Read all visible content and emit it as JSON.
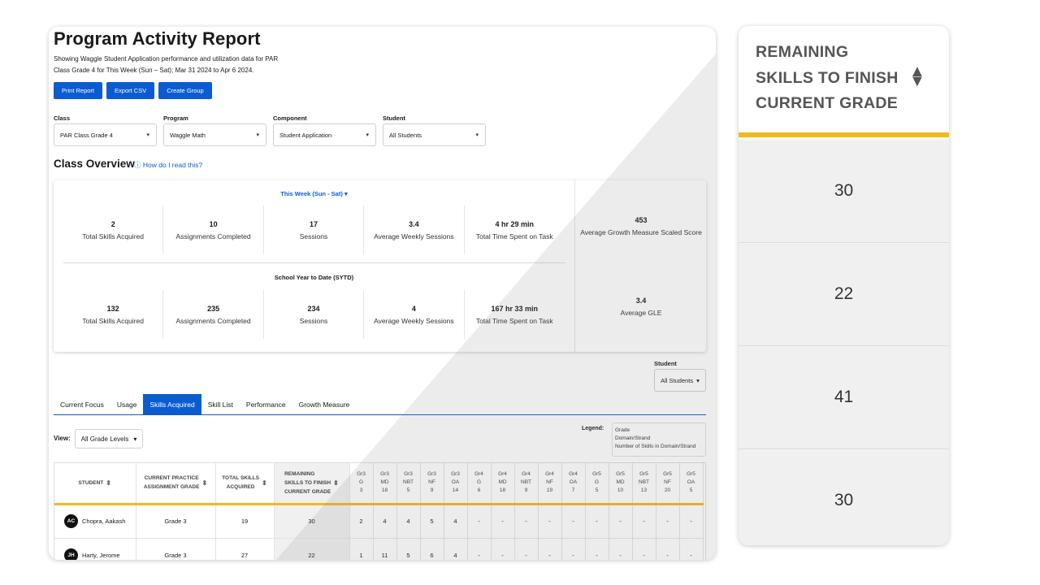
{
  "header": {
    "title": "Program Activity Report",
    "subtitle_line1": "Showing Waggle Student Application performance and utilization data for PAR",
    "subtitle_line2": "Class Grade 4 for This Week (Sun – Sat); Mar 31 2024 to Apr 6 2024."
  },
  "actions": {
    "print": "Print Report",
    "export": "Export CSV",
    "create_group": "Create Group"
  },
  "filters": [
    {
      "label": "Class",
      "value": "PAR Class Grade 4"
    },
    {
      "label": "Program",
      "value": "Waggle Math"
    },
    {
      "label": "Component",
      "value": "Student Application"
    },
    {
      "label": "Student",
      "value": "All Students"
    }
  ],
  "overview": {
    "title": "Class Overview",
    "help_link": "How do I read this?",
    "week_label": "This Week (Sun - Sat)",
    "week_stats": [
      {
        "value": "2",
        "label": "Total Skills Acquired"
      },
      {
        "value": "10",
        "label": "Assignments Completed"
      },
      {
        "value": "17",
        "label": "Sessions"
      },
      {
        "value": "3.4",
        "label": "Average Weekly Sessions"
      },
      {
        "value": "4 hr 29 min",
        "label": "Total Time Spent on Task"
      }
    ],
    "sytd_label": "School Year to Date (SYTD)",
    "sytd_stats": [
      {
        "value": "132",
        "label": "Total Skills Acquired"
      },
      {
        "value": "235",
        "label": "Assignments Completed"
      },
      {
        "value": "234",
        "label": "Sessions"
      },
      {
        "value": "4",
        "label": "Average Weekly Sessions"
      },
      {
        "value": "167 hr 33 min",
        "label": "Total Time Spent on Task"
      }
    ],
    "growth": {
      "value": "453",
      "label": "Average Growth Measure Scaled Score"
    },
    "gle": {
      "value": "3.4",
      "label": "Average GLE"
    }
  },
  "student_filter": {
    "label": "Student",
    "value": "All Students"
  },
  "tabs": [
    "Current Focus",
    "Usage",
    "Skills Acquired",
    "Skill List",
    "Performance",
    "Growth Measure"
  ],
  "view": {
    "label": "View:",
    "value": "All Grade Levels"
  },
  "legend": {
    "label": "Legend:",
    "line1": "Grade",
    "line2": "Domain/Strand",
    "line3": "Number of Skills in Domain/Strand"
  },
  "table": {
    "headers": {
      "student": "STUDENT",
      "practice_l1": "CURRENT PRACTICE",
      "practice_l2": "ASSIGNMENT GRADE",
      "total_l1": "TOTAL SKILLS",
      "total_l2": "ACQUIRED",
      "remaining_l1": "REMAINING",
      "remaining_l2": "SKILLS TO FINISH",
      "remaining_l3": "CURRENT GRADE"
    },
    "grade_cols": [
      {
        "g": "Gr3",
        "d": "G",
        "n": "3"
      },
      {
        "g": "Gr3",
        "d": "MD",
        "n": "18"
      },
      {
        "g": "Gr3",
        "d": "NBT",
        "n": "5"
      },
      {
        "g": "Gr3",
        "d": "NF",
        "n": "9"
      },
      {
        "g": "Gr3",
        "d": "OA",
        "n": "14"
      },
      {
        "g": "Gr4",
        "d": "G",
        "n": "6"
      },
      {
        "g": "Gr4",
        "d": "MD",
        "n": "18"
      },
      {
        "g": "Gr4",
        "d": "NBT",
        "n": "9"
      },
      {
        "g": "Gr4",
        "d": "NF",
        "n": "19"
      },
      {
        "g": "Gr4",
        "d": "OA",
        "n": "7"
      },
      {
        "g": "Gr5",
        "d": "G",
        "n": "5"
      },
      {
        "g": "Gr5",
        "d": "MD",
        "n": "10"
      },
      {
        "g": "Gr5",
        "d": "NBT",
        "n": "13"
      },
      {
        "g": "Gr5",
        "d": "NF",
        "n": "20"
      },
      {
        "g": "Gr5",
        "d": "OA",
        "n": "5"
      }
    ],
    "rows": [
      {
        "initials": "AC",
        "name": "Chopra, Aakash",
        "grade": "Grade 3",
        "total": "19",
        "remaining": "30",
        "cells": [
          "2",
          "4",
          "4",
          "5",
          "4",
          "-",
          "-",
          "-",
          "-",
          "-",
          "-",
          "-",
          "-",
          "-",
          "-"
        ]
      },
      {
        "initials": "JH",
        "name": "Harty, Jerome",
        "grade": "Grade 3",
        "total": "27",
        "remaining": "22",
        "cells": [
          "1",
          "11",
          "5",
          "6",
          "4",
          "-",
          "-",
          "-",
          "-",
          "-",
          "-",
          "-",
          "-",
          "-",
          "-"
        ]
      }
    ]
  },
  "callout": {
    "line1": "REMAINING",
    "line2": "SKILLS TO FINISH",
    "line3": "CURRENT GRADE",
    "values": [
      "30",
      "22",
      "41",
      "30"
    ]
  },
  "colors": {
    "accent": "#0b5cd3",
    "highlight": "#f5b81a",
    "grey_column": "#f0f0f0"
  }
}
